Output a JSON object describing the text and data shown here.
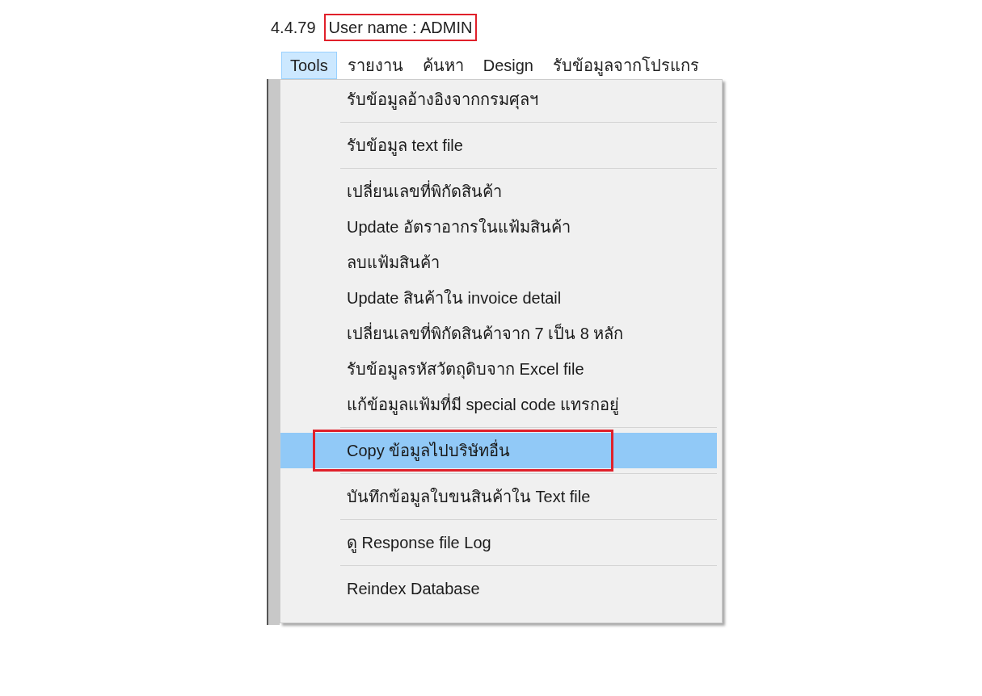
{
  "header": {
    "version": "4.4.79",
    "user_label": "User name : ADMIN",
    "user_annotated": true
  },
  "menu_bar": [
    {
      "label": "Tools",
      "selected": true
    },
    {
      "label": "รายงาน",
      "selected": false
    },
    {
      "label": "ค้นหา",
      "selected": false
    },
    {
      "label": "Design",
      "selected": false
    },
    {
      "label": "รับข้อมูลจากโปรแกร",
      "selected": false
    }
  ],
  "dropdown": [
    {
      "kind": "item",
      "label": "รับข้อมูลอ้างอิงจากกรมศุลฯ",
      "selected": false,
      "annotated": false
    },
    {
      "kind": "separator"
    },
    {
      "kind": "item",
      "label": "รับข้อมูล text file",
      "selected": false,
      "annotated": false
    },
    {
      "kind": "separator"
    },
    {
      "kind": "item",
      "label": "เปลี่ยนเลขที่พิกัดสินค้า",
      "selected": false,
      "annotated": false
    },
    {
      "kind": "item",
      "label": "Update อัตราอากรในแฟ้มสินค้า",
      "selected": false,
      "annotated": false
    },
    {
      "kind": "item",
      "label": "ลบแฟ้มสินค้า",
      "selected": false,
      "annotated": false
    },
    {
      "kind": "item",
      "label": "Update สินค้าใน invoice detail",
      "selected": false,
      "annotated": false
    },
    {
      "kind": "item",
      "label": "เปลี่ยนเลขที่พิกัดสินค้าจาก 7 เป็น 8 หลัก",
      "selected": false,
      "annotated": false
    },
    {
      "kind": "item",
      "label": "รับข้อมูลรหัสวัตถุดิบจาก Excel file",
      "selected": false,
      "annotated": false
    },
    {
      "kind": "item",
      "label": "แก้ข้อมูลแฟ้มที่มี special code แทรกอยู่",
      "selected": false,
      "annotated": false
    },
    {
      "kind": "separator"
    },
    {
      "kind": "item",
      "label": "Copy ข้อมูลไปบริษัทอื่น",
      "selected": true,
      "annotated": true
    },
    {
      "kind": "separator"
    },
    {
      "kind": "item",
      "label": "บันทึกข้อมูลใบขนสินค้าใน Text file",
      "selected": false,
      "annotated": false
    },
    {
      "kind": "separator"
    },
    {
      "kind": "item",
      "label": "ดู Response file Log",
      "selected": false,
      "annotated": false
    },
    {
      "kind": "separator"
    },
    {
      "kind": "item",
      "label": "Reindex Database",
      "selected": false,
      "annotated": false
    }
  ]
}
